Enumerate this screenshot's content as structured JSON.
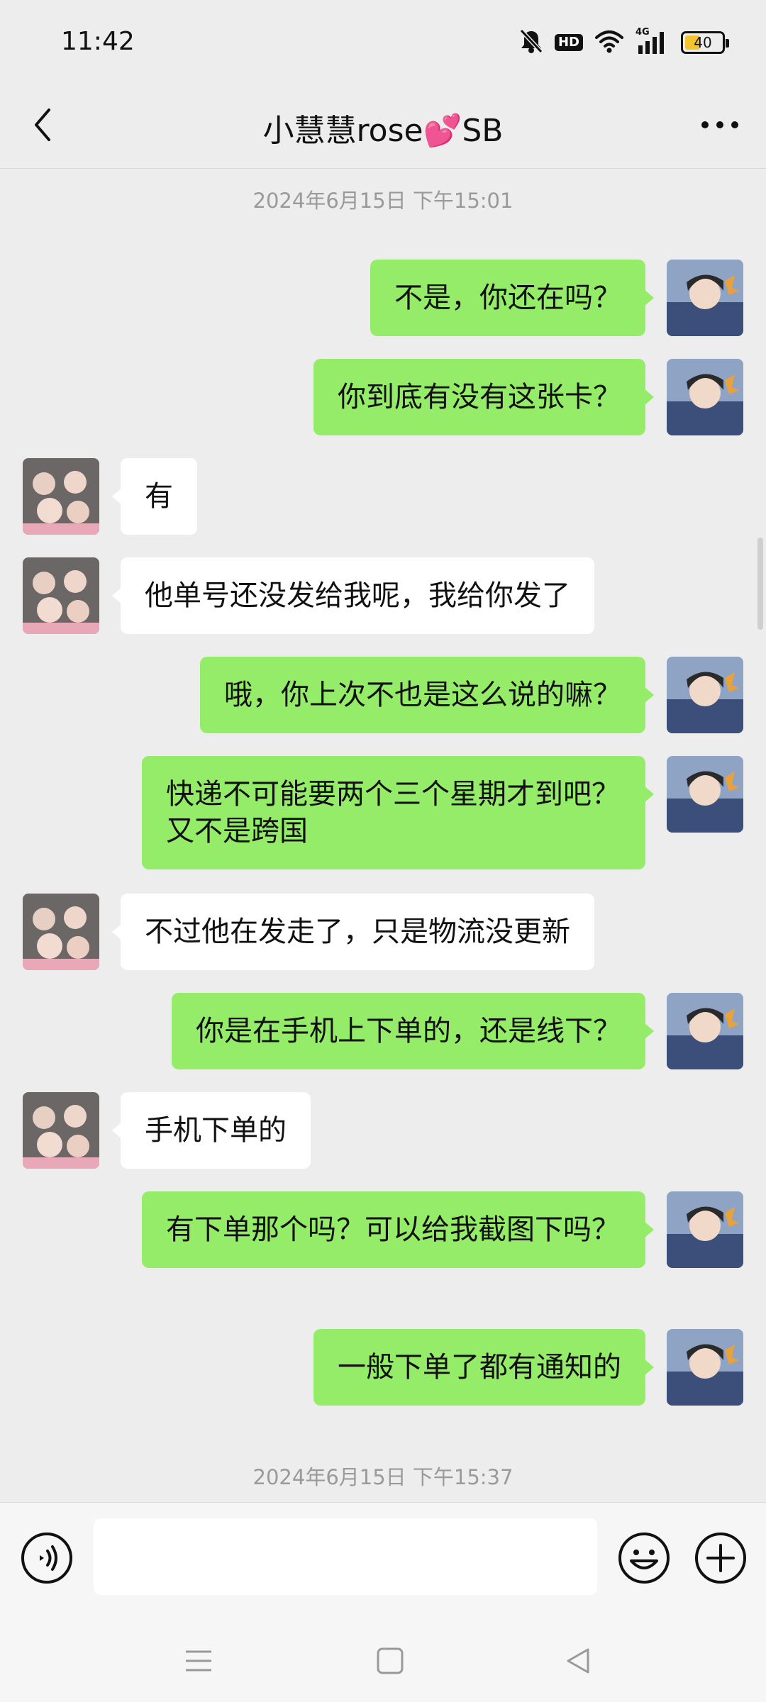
{
  "status_bar": {
    "time": "11:42",
    "hd_label": "HD",
    "network": "4G",
    "battery": "40",
    "battery_level": 0.4
  },
  "header": {
    "title": "小慧慧rose💕SB"
  },
  "chat": {
    "timestamps": [
      "2024年6月15日 下午15:01",
      "2024年6月15日 下午15:37"
    ],
    "messages": [
      {
        "side": "right",
        "text": "不是，你还在吗？"
      },
      {
        "side": "right",
        "text": "你到底有没有这张卡？"
      },
      {
        "side": "left",
        "text": "有"
      },
      {
        "side": "left",
        "text": "他单号还没发给我呢，我给你发了"
      },
      {
        "side": "right",
        "text": "哦，你上次不也是这么说的嘛？"
      },
      {
        "side": "right",
        "text": "快递不可能要两个三个星期才到吧？又不是跨国"
      },
      {
        "side": "left",
        "text": "不过他在发走了，只是物流没更新"
      },
      {
        "side": "right",
        "text": "你是在手机上下单的，还是线下？"
      },
      {
        "side": "left",
        "text": "手机下单的"
      },
      {
        "side": "right",
        "text": "有下单那个吗？可以给我截图下吗？"
      },
      {
        "side": "right",
        "text": "一般下单了都有通知的"
      }
    ]
  },
  "input_bar": {
    "value": "",
    "placeholder": ""
  },
  "icons": {
    "back": "chevron-left-icon",
    "more": "more-dots-icon",
    "voice": "voice-icon",
    "emoji": "emoji-icon",
    "plus": "plus-icon",
    "menu": "menu-icon",
    "home": "home-icon",
    "back_nav": "triangle-back-icon"
  },
  "colors": {
    "sent_bubble": "#95ec69",
    "received_bubble": "#ffffff",
    "background": "#ededed",
    "battery_fill": "#f4c430"
  }
}
